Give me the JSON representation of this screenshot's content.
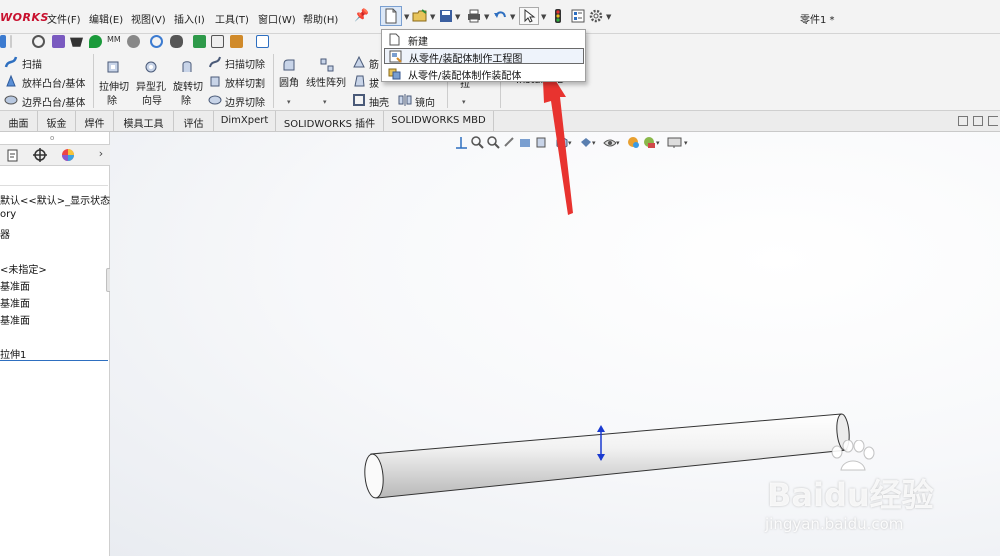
{
  "app": {
    "brand": "WORKS",
    "document_title": "零件1 *"
  },
  "menu": [
    "文件(F)",
    "编辑(E)",
    "视图(V)",
    "插入(I)",
    "工具(T)",
    "窗口(W)",
    "帮助(H)"
  ],
  "dropdown": {
    "items": [
      {
        "label": "新建",
        "icon": "blank-document-icon"
      },
      {
        "label": "从零件/装配体制作工程图",
        "icon": "drawing-from-part-icon"
      },
      {
        "label": "从零件/装配体制作装配体",
        "icon": "assembly-from-part-icon"
      }
    ]
  },
  "command_manager": {
    "sweep": "扫描",
    "loft_boss": "放样凸台/基体",
    "boundary_boss": "边界凸台/基体",
    "extruded_cut_l1": "拉伸切",
    "extruded_cut_l2": "除",
    "hole_wizard_l1": "异型孔",
    "hole_wizard_l2": "向导",
    "revolved_cut_l1": "旋转切",
    "revolved_cut_l2": "除",
    "swept_cut": "扫描切除",
    "lofted_cut": "放样切割",
    "boundary_cut": "边界切除",
    "fillet": "圆角",
    "linear_pattern": "线性阵列",
    "rib": "筋",
    "draft": "拔",
    "shell": "抽壳",
    "mirror": "镜向",
    "partial_1": "拉",
    "partial_2": "Instant3D"
  },
  "tabs": [
    "曲面",
    "钣金",
    "焊件",
    "模具工具",
    "评估",
    "DimXpert",
    "SOLIDWORKS 插件",
    "SOLIDWORKS MBD"
  ],
  "feature_tree": {
    "config_line": "默认<<默认>_显示状态",
    "items": [
      "ory",
      "器",
      "<未指定>",
      "基准面",
      "基准面",
      "基准面",
      "拉伸1"
    ]
  },
  "watermark": {
    "brand": "Baidu经验",
    "url": "jingyan.baidu.com"
  },
  "colors": {
    "accent_red": "#c8102e",
    "arrow_red": "#e8332f",
    "selection_blue": "#2e6fc0"
  }
}
